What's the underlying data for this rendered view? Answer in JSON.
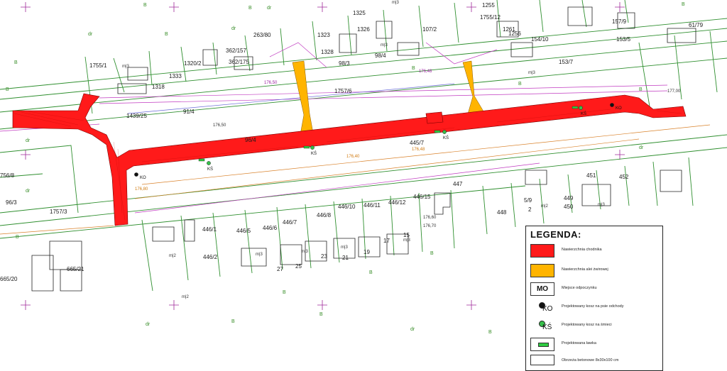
{
  "map": {
    "parcels": [
      "1325",
      "1255",
      "1755/12",
      "1261",
      "1256",
      "154/10",
      "157/9",
      "61/79",
      "1323",
      "1328",
      "1326",
      "1320/2",
      "1333",
      "1318",
      "1755/1",
      "362/175",
      "362/157",
      "263/80",
      "107/2",
      "98/4",
      "98/3",
      "153/5",
      "153/7",
      "1757/6",
      "1439/25",
      "91/4",
      "96/4",
      "445/7",
      "451",
      "452",
      "447",
      "446/15",
      "446/12",
      "446/11",
      "446/10",
      "446/8",
      "446/7",
      "446/6",
      "446/5",
      "446/1",
      "446/2",
      "449",
      "450",
      "448",
      "756/8",
      "96/3",
      "1757/3",
      "665/21",
      "665/20",
      "5/9",
      "2"
    ],
    "parcel_colors": {
      "green": "#2f8f2f",
      "black": "#222222"
    },
    "poi_labels": {
      "ko": "KO",
      "ks": "KŚ"
    },
    "land_codes": [
      "B",
      "dr",
      "m|3",
      "m|2"
    ],
    "house_numbers": [
      "27",
      "25",
      "23",
      "21",
      "19",
      "17",
      "15"
    ],
    "elevation_samples": [
      "176,40",
      "176,48",
      "176,50",
      "177,00",
      "176,80",
      "176,60",
      "176,70"
    ],
    "surface_colors": {
      "sidewalk": "#ff1a1a",
      "gravel_path": "#ffb400"
    }
  },
  "legend": {
    "title": "LEGENDA:",
    "items": [
      {
        "label": "Nawierzchnia chodnika",
        "symbol": "red-fill"
      },
      {
        "label": "Nawierzchnia alei żwirowej",
        "symbol": "orange-fill"
      },
      {
        "label": "Miejsce odpoczynku",
        "symbol": "MO"
      },
      {
        "label": "Projektowany kosz na psie odchody",
        "symbol": "KO"
      },
      {
        "label": "Projektowany kosz na śmieci",
        "symbol": "KŚ"
      },
      {
        "label": "Projektowana ławka",
        "symbol": "bench"
      },
      {
        "label": "Obrzeża betonowe 8x30x100 cm",
        "symbol": "edge"
      }
    ],
    "mo_text": "MO",
    "ko_text": "KO",
    "ks_text": "KŚ"
  }
}
